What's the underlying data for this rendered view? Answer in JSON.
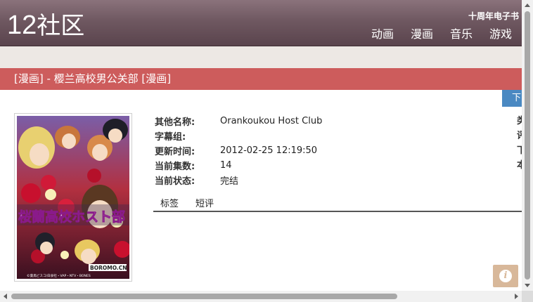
{
  "header": {
    "logo_num": "12",
    "logo_text": "社区",
    "promo": "十周年电子书",
    "nav": [
      "动画",
      "漫画",
      "音乐",
      "游戏"
    ]
  },
  "title_bar": {
    "text": "[漫画] - 樱兰高校男公关部 [漫画]"
  },
  "download_button": "下",
  "cover": {
    "title_art": "桜蘭高校ホスト部",
    "label": "BOROMO.CN",
    "credit": "©葉鳥ビスコ/白泉社・VAP・NTV・BONES"
  },
  "details": [
    {
      "label": "其他名称:",
      "value": "Orankoukou Host Club"
    },
    {
      "label": "字幕组:",
      "value": ""
    },
    {
      "label": "更新时间:",
      "value": "2012-02-25 12:19:50"
    },
    {
      "label": "当前集数:",
      "value": "14"
    },
    {
      "label": "当前状态:",
      "value": "完结"
    }
  ],
  "right_column": [
    "类",
    "评",
    "下",
    "本"
  ],
  "tabs": [
    "标签",
    "短评"
  ],
  "colors": {
    "header": "#6f5861",
    "title_bar": "#cd5c5c",
    "download": "#4a89c2",
    "info_badge": "#d8b89a"
  }
}
